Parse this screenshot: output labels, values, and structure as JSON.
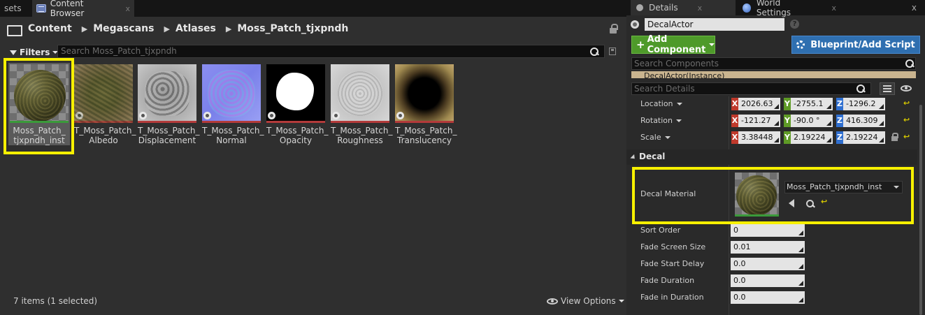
{
  "content_browser": {
    "tabs": [
      {
        "label": "sets"
      },
      {
        "label": "Content Browser",
        "close": "x"
      }
    ],
    "path": [
      "Content",
      "Megascans",
      "Atlases",
      "Moss_Patch_tjxpndh"
    ],
    "filters_label": "Filters",
    "search_placeholder": "Search Moss_Patch_tjxpndh",
    "assets": [
      {
        "name_line1": "Moss_Patch_",
        "name_line2": "tjxpndh_inst",
        "kind": "material-instance",
        "selected": true
      },
      {
        "name_line1": "T_Moss_Patch_",
        "name_line2": "Albedo",
        "kind": "texture"
      },
      {
        "name_line1": "T_Moss_Patch_",
        "name_line2": "Displacement",
        "kind": "texture"
      },
      {
        "name_line1": "T_Moss_Patch_",
        "name_line2": "Normal",
        "kind": "texture"
      },
      {
        "name_line1": "T_Moss_Patch_",
        "name_line2": "Opacity",
        "kind": "texture"
      },
      {
        "name_line1": "T_Moss_Patch_",
        "name_line2": "Roughness",
        "kind": "texture"
      },
      {
        "name_line1": "T_Moss_Patch_",
        "name_line2": "Translucency",
        "kind": "texture"
      }
    ],
    "status": "7 items (1 selected)",
    "view_options": "View Options"
  },
  "details": {
    "tabs": [
      {
        "label": "Details",
        "close": "x"
      },
      {
        "label": "World Settings",
        "close": "x"
      }
    ],
    "panel_close": "x",
    "actor_name": "DecalActor",
    "help": "?",
    "add_component": "Add Component",
    "add_component_plus": "+",
    "blueprint_button": "Blueprint/Add Script",
    "component_search_placeholder": "Search Components",
    "component_tree_item": "DecalActor(Instance)",
    "details_search_placeholder": "Search Details",
    "transform": [
      {
        "label": "Location",
        "x": "2026.63",
        "y": "-2755.1",
        "z": "-1296.2"
      },
      {
        "label": "Rotation",
        "x": "-121.27",
        "y": "-90.0 °",
        "z": "416.309"
      },
      {
        "label": "Scale",
        "x": "3.38448",
        "y": "2.19224",
        "z": "2.19224"
      }
    ],
    "axis_labels": {
      "x": "X",
      "y": "Y",
      "z": "Z"
    },
    "reset_glyph": "↩",
    "category_decal": "Decal",
    "decal_material_label": "Decal Material",
    "decal_material_value": "Moss_Patch_tjxpndh_inst",
    "scalar_props": [
      {
        "label": "Sort Order",
        "value": "0"
      },
      {
        "label": "Fade Screen Size",
        "value": "0.01"
      },
      {
        "label": "Fade Start Delay",
        "value": "0.0"
      },
      {
        "label": "Fade Duration",
        "value": "0.0"
      },
      {
        "label": "Fade in Duration",
        "value": "0.0"
      }
    ]
  },
  "colors": {
    "highlight": "#f7f000",
    "add_component": "#4e9a2a",
    "blueprint": "#2f6fb0",
    "axis_x": "#c0392b",
    "axis_y": "#5f9b26",
    "axis_z": "#2f6fd0"
  }
}
